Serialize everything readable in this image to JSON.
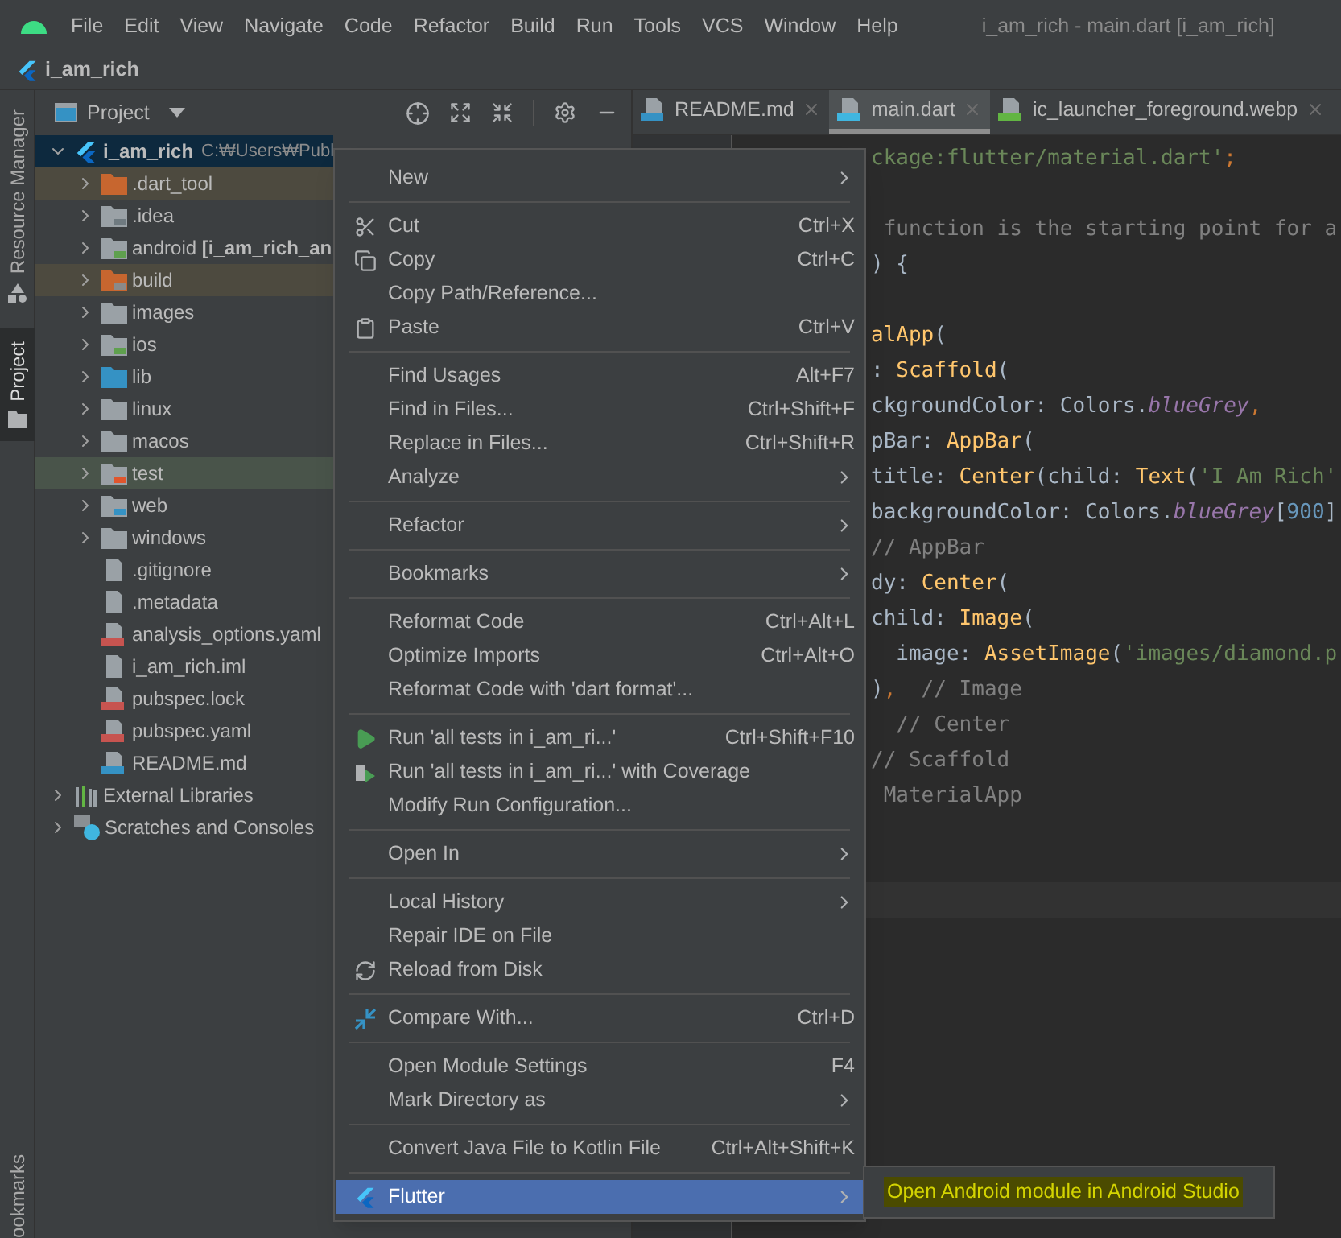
{
  "menu_bar": {
    "items": [
      "File",
      "Edit",
      "View",
      "Navigate",
      "Code",
      "Refactor",
      "Build",
      "Run",
      "Tools",
      "VCS",
      "Window",
      "Help"
    ]
  },
  "window": {
    "title": "i_am_rich - main.dart [i_am_rich]"
  },
  "breadcrumb": {
    "label": "i_am_rich"
  },
  "side_stripe": {
    "tabs": [
      {
        "label": "Resource Manager",
        "selected": false
      },
      {
        "label": "Project",
        "selected": true
      }
    ],
    "bottom_tab": "ookmarks"
  },
  "project_panel": {
    "title": "Project",
    "tree": [
      {
        "label": "i_am_rich",
        "path": "C:₩Users₩Publ",
        "kind": "module",
        "expanded": true,
        "selected": true,
        "children": [
          {
            "label": ".dart_tool",
            "kind": "folder",
            "expanded": false,
            "selected": false,
            "color": "#4d4a3f"
          },
          {
            "label": ".idea",
            "kind": "folder",
            "expanded": false,
            "selected": false
          },
          {
            "label": "android **[i_am_rich_an**",
            "kind": "folder",
            "expanded": false,
            "selected": false
          },
          {
            "label": "build",
            "kind": "folder",
            "expanded": false,
            "selected": false,
            "color": "#4d4a3f"
          },
          {
            "label": "images",
            "kind": "folder",
            "expanded": false,
            "selected": false
          },
          {
            "label": "ios",
            "kind": "folder",
            "expanded": false,
            "selected": false
          },
          {
            "label": "lib",
            "kind": "folder",
            "expanded": false,
            "selected": false
          },
          {
            "label": "linux",
            "kind": "folder",
            "expanded": false,
            "selected": false
          },
          {
            "label": "macos",
            "kind": "folder",
            "expanded": false,
            "selected": false
          },
          {
            "label": "test",
            "kind": "folder",
            "expanded": false,
            "selected": false,
            "color": "#49544a"
          },
          {
            "label": "web",
            "kind": "folder",
            "expanded": false,
            "selected": false
          },
          {
            "label": "windows",
            "kind": "folder",
            "expanded": false,
            "selected": false
          },
          {
            "label": ".gitignore",
            "kind": "file",
            "selected": false
          },
          {
            "label": ".metadata",
            "kind": "file",
            "selected": false
          },
          {
            "label": "analysis_options.yaml",
            "kind": "yaml",
            "selected": false
          },
          {
            "label": "i_am_rich.iml",
            "kind": "file",
            "selected": false
          },
          {
            "label": "pubspec.lock",
            "kind": "yaml",
            "selected": false
          },
          {
            "label": "pubspec.yaml",
            "kind": "yaml",
            "selected": false
          },
          {
            "label": "README.md",
            "kind": "markdown",
            "selected": false
          }
        ]
      },
      {
        "label": "External Libraries",
        "kind": "library",
        "expanded": false,
        "selected": false
      },
      {
        "label": "Scratches and Consoles",
        "kind": "scratches",
        "expanded": false,
        "selected": false
      }
    ]
  },
  "editor": {
    "tabs": [
      {
        "label": "README.md",
        "kind": "markdown",
        "selected": false
      },
      {
        "label": "main.dart",
        "kind": "dart",
        "selected": true
      },
      {
        "label": "ic_launcher_foreground.webp",
        "kind": "image",
        "selected": false
      }
    ],
    "code_lines": [
      {
        "kind": "code",
        "tokens": [
          {
            "text": "ckage:flutter/material.dart'",
            "kind": "string"
          },
          {
            "text": ";",
            "kind": "keyword"
          }
        ]
      },
      {
        "kind": "blank"
      },
      {
        "kind": "code",
        "tokens": [
          {
            "text": " function is the starting point for a",
            "kind": "comment"
          }
        ]
      },
      {
        "kind": "code",
        "tokens": [
          {
            "text": ") {",
            "kind": "plain"
          }
        ]
      },
      {
        "kind": "blank"
      },
      {
        "kind": "code",
        "tokens": [
          {
            "text": "alApp",
            "kind": "call"
          },
          {
            "text": "(",
            "kind": "plain"
          }
        ]
      },
      {
        "kind": "code",
        "tokens": [
          {
            "text": ": ",
            "kind": "plain"
          },
          {
            "text": "Scaffold",
            "kind": "call"
          },
          {
            "text": "(",
            "kind": "plain"
          }
        ]
      },
      {
        "kind": "code",
        "tokens": [
          {
            "text": "ckgroundColor: Colors.",
            "kind": "plain"
          },
          {
            "text": "blueGrey",
            "kind": "field"
          },
          {
            "text": ",",
            "kind": "keyword"
          }
        ]
      },
      {
        "kind": "code",
        "tokens": [
          {
            "text": "pBar: ",
            "kind": "plain"
          },
          {
            "text": "AppBar",
            "kind": "call"
          },
          {
            "text": "(",
            "kind": "plain"
          }
        ]
      },
      {
        "kind": "code",
        "tokens": [
          {
            "text": "title: ",
            "kind": "plain"
          },
          {
            "text": "Center",
            "kind": "call"
          },
          {
            "text": "(child: ",
            "kind": "plain"
          },
          {
            "text": "Text",
            "kind": "call"
          },
          {
            "text": "(",
            "kind": "plain"
          },
          {
            "text": "'I Am Rich'",
            "kind": "string"
          }
        ]
      },
      {
        "kind": "code",
        "tokens": [
          {
            "text": "backgroundColor: Colors.",
            "kind": "plain"
          },
          {
            "text": "blueGrey",
            "kind": "field"
          },
          {
            "text": "[",
            "kind": "plain"
          },
          {
            "text": "900",
            "kind": "number"
          },
          {
            "text": "]",
            "kind": "plain"
          }
        ]
      },
      {
        "kind": "code",
        "tokens": [
          {
            "text": "// AppBar",
            "kind": "comment"
          }
        ]
      },
      {
        "kind": "code",
        "tokens": [
          {
            "text": "dy: ",
            "kind": "plain"
          },
          {
            "text": "Center",
            "kind": "call"
          },
          {
            "text": "(",
            "kind": "plain"
          }
        ]
      },
      {
        "kind": "code",
        "tokens": [
          {
            "text": "child: ",
            "kind": "plain"
          },
          {
            "text": "Image",
            "kind": "call"
          },
          {
            "text": "(",
            "kind": "plain"
          }
        ]
      },
      {
        "kind": "code",
        "tokens": [
          {
            "text": "  image: ",
            "kind": "plain"
          },
          {
            "text": "AssetImage",
            "kind": "call"
          },
          {
            "text": "(",
            "kind": "plain"
          },
          {
            "text": "'images/diamond.p",
            "kind": "string"
          }
        ]
      },
      {
        "kind": "code",
        "tokens": [
          {
            "text": ")",
            "kind": "plain"
          },
          {
            "text": ",",
            "kind": "keyword"
          },
          {
            "text": "  // Image",
            "kind": "comment"
          }
        ]
      },
      {
        "kind": "code",
        "tokens": [
          {
            "text": "  // Center",
            "kind": "comment"
          }
        ]
      },
      {
        "kind": "code",
        "tokens": [
          {
            "text": "// Scaffold",
            "kind": "comment"
          }
        ]
      },
      {
        "kind": "code",
        "tokens": [
          {
            "text": " MaterialApp",
            "kind": "comment"
          }
        ]
      },
      {
        "kind": "blank"
      },
      {
        "kind": "blank"
      }
    ],
    "current_line": true
  },
  "context_menu": {
    "items": [
      {
        "kind": "item",
        "label": "New",
        "submenu": true,
        "selected": false
      },
      {
        "kind": "separator"
      },
      {
        "kind": "item",
        "label": "Cut",
        "shortcut": "Ctrl+X",
        "submenu": false,
        "selected": false
      },
      {
        "kind": "item",
        "label": "Copy",
        "shortcut": "Ctrl+C",
        "submenu": false,
        "selected": false
      },
      {
        "kind": "item",
        "label": "Copy Path/Reference...",
        "submenu": false,
        "selected": false
      },
      {
        "kind": "item",
        "label": "Paste",
        "shortcut": "Ctrl+V",
        "submenu": false,
        "selected": false
      },
      {
        "kind": "separator"
      },
      {
        "kind": "item",
        "label": "Find Usages",
        "shortcut": "Alt+F7",
        "submenu": false,
        "selected": false
      },
      {
        "kind": "item",
        "label": "Find in Files...",
        "shortcut": "Ctrl+Shift+F",
        "submenu": false,
        "selected": false
      },
      {
        "kind": "item",
        "label": "Replace in Files...",
        "shortcut": "Ctrl+Shift+R",
        "submenu": false,
        "selected": false
      },
      {
        "kind": "item",
        "label": "Analyze",
        "submenu": true,
        "selected": false
      },
      {
        "kind": "separator"
      },
      {
        "kind": "item",
        "label": "Refactor",
        "submenu": true,
        "selected": false
      },
      {
        "kind": "separator"
      },
      {
        "kind": "item",
        "label": "Bookmarks",
        "submenu": true,
        "selected": false
      },
      {
        "kind": "separator"
      },
      {
        "kind": "item",
        "label": "Reformat Code",
        "shortcut": "Ctrl+Alt+L",
        "submenu": false,
        "selected": false
      },
      {
        "kind": "item",
        "label": "Optimize Imports",
        "shortcut": "Ctrl+Alt+O",
        "submenu": false,
        "selected": false
      },
      {
        "kind": "item",
        "label": "Reformat Code with 'dart format'...",
        "submenu": false,
        "selected": false
      },
      {
        "kind": "separator"
      },
      {
        "kind": "item",
        "label": "Run 'all tests in i_am_ri...'",
        "shortcut": "Ctrl+Shift+F10",
        "submenu": false,
        "selected": false
      },
      {
        "kind": "item",
        "label": "Run 'all tests in i_am_ri...' with Coverage",
        "submenu": false,
        "selected": false
      },
      {
        "kind": "item",
        "label": "Modify Run Configuration...",
        "submenu": false,
        "selected": false
      },
      {
        "kind": "separator"
      },
      {
        "kind": "item",
        "label": "Open In",
        "submenu": true,
        "selected": false
      },
      {
        "kind": "separator"
      },
      {
        "kind": "item",
        "label": "Local History",
        "submenu": true,
        "selected": false
      },
      {
        "kind": "item",
        "label": "Repair IDE on File",
        "submenu": false,
        "selected": false
      },
      {
        "kind": "item",
        "label": "Reload from Disk",
        "submenu": false,
        "selected": false
      },
      {
        "kind": "separator"
      },
      {
        "kind": "item",
        "label": "Compare With...",
        "shortcut": "Ctrl+D",
        "submenu": false,
        "selected": false
      },
      {
        "kind": "separator"
      },
      {
        "kind": "item",
        "label": "Open Module Settings",
        "shortcut": "F4",
        "submenu": false,
        "selected": false
      },
      {
        "kind": "item",
        "label": "Mark Directory as",
        "submenu": true,
        "selected": false
      },
      {
        "kind": "separator"
      },
      {
        "kind": "item",
        "label": "Convert Java File to Kotlin File",
        "shortcut": "Ctrl+Alt+Shift+K",
        "submenu": false,
        "selected": false
      },
      {
        "kind": "separator"
      },
      {
        "kind": "item",
        "label": "Flutter",
        "submenu": true,
        "selected": true
      }
    ]
  },
  "submenu": {
    "items": [
      {
        "label": "Open Android module in Android Studio",
        "highlighted": true
      }
    ]
  }
}
